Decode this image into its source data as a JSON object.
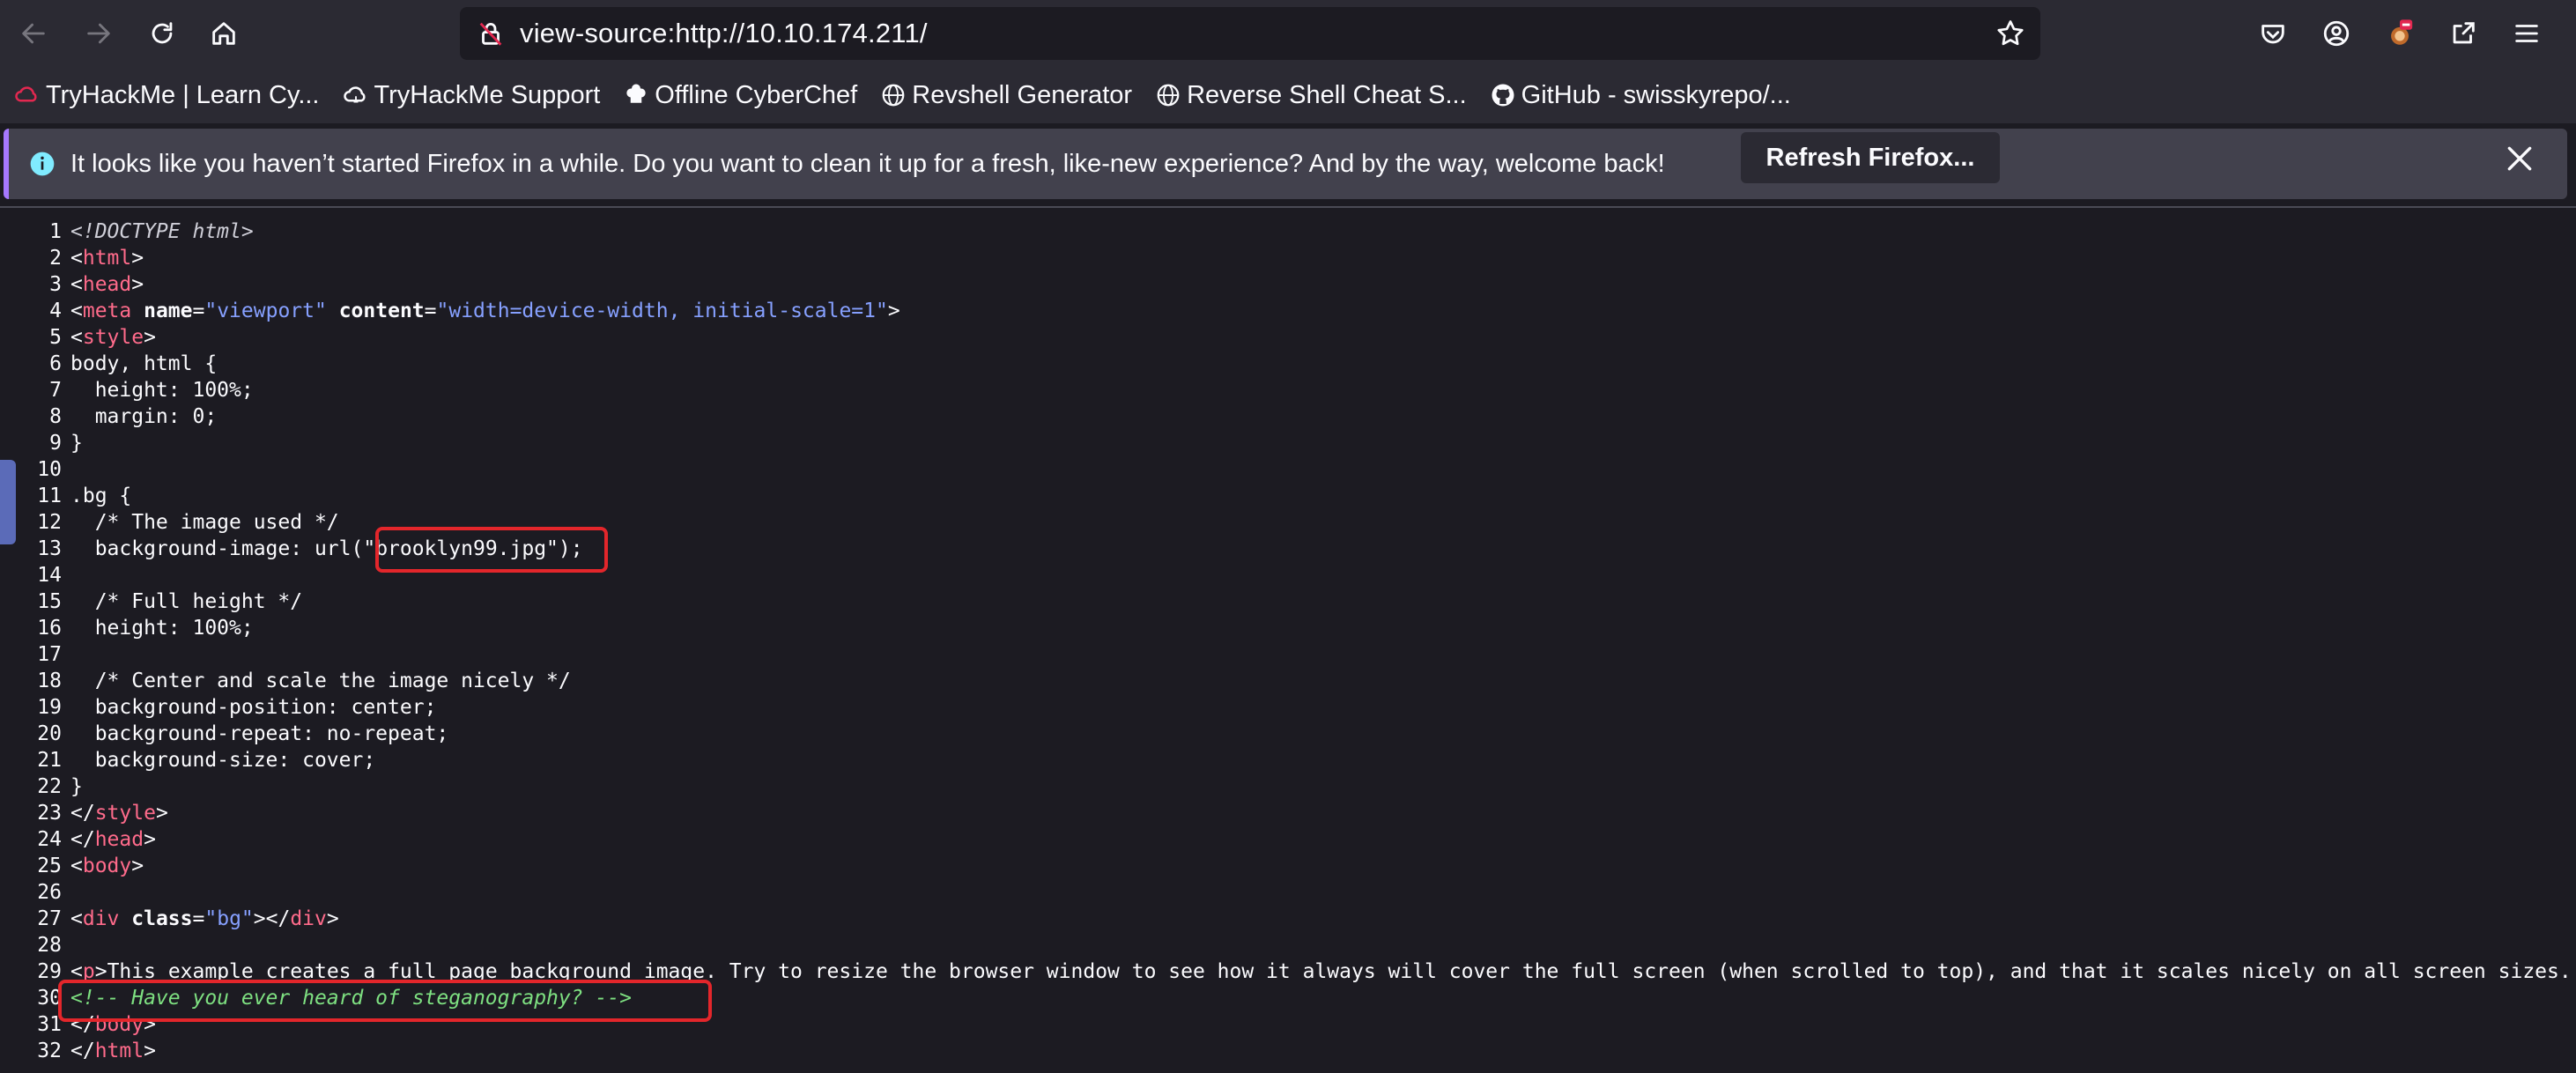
{
  "toolbar": {
    "url": "view-source:http://10.10.174.211/",
    "icons": [
      "back-arrow-icon",
      "forward-arrow-icon",
      "reload-icon",
      "home-icon",
      "lock-icon",
      "star-icon",
      "pocket-icon",
      "account-icon",
      "extension-icon",
      "share-icon",
      "menu-icon"
    ]
  },
  "bookmarks": [
    {
      "label": "TryHackMe | Learn Cy...",
      "icon": "tryhackme-icon"
    },
    {
      "label": "TryHackMe Support",
      "icon": "support-icon"
    },
    {
      "label": "Offline CyberChef",
      "icon": "chef-icon"
    },
    {
      "label": "Revshell Generator",
      "icon": "globe-icon"
    },
    {
      "label": "Reverse Shell Cheat S...",
      "icon": "globe-icon"
    },
    {
      "label": "GitHub - swisskyrepo/...",
      "icon": "github-icon"
    }
  ],
  "notification": {
    "message": "It looks like you haven’t started Firefox in a while. Do you want to clean it up for a fresh, like-new experience? And by the way, welcome back!",
    "button": "Refresh Firefox..."
  },
  "source": {
    "line_numbers": [
      "1",
      "2",
      "3",
      "4",
      "5",
      "6",
      "7",
      "8",
      "9",
      "10",
      "11",
      "12",
      "13",
      "14",
      "15",
      "16",
      "17",
      "18",
      "19",
      "20",
      "21",
      "22",
      "23",
      "24",
      "25",
      "26",
      "27",
      "28",
      "29",
      "30",
      "31",
      "32"
    ],
    "text": {
      "doctype": "<!DOCTYPE html>",
      "html": "html",
      "head": "head",
      "meta": "meta",
      "style": "style",
      "body": "body",
      "div": "div",
      "p": "p",
      "name_attr": "name",
      "name_val": "\"viewport\"",
      "content_attr": "content",
      "content_val": "\"width=device-width, initial-scale=1\"",
      "l6": "body, html {",
      "l7": "  height: 100%;",
      "l8": "  margin: 0;",
      "l9": "}",
      "l11": ".bg {",
      "l12": "  /* The image used */",
      "l13a": "  background-image: url(",
      "l13b": "\"brooklyn99.jpg\");",
      "l15": "  /* Full height */",
      "l16": "  height: 100%;",
      "l18": "  /* Center and scale the image nicely */",
      "l19": "  background-position: center;",
      "l20": "  background-repeat: no-repeat;",
      "l21": "  background-size: cover;",
      "l22": "}",
      "class_attr": "class",
      "class_val": "\"bg\"",
      "l29": "This example creates a full page background image. Try to resize the browser window to see how it always will cover the full screen (when scrolled to top), and that it scales nicely on all screen sizes.",
      "l30": "<!-- Have you ever heard of steganography? -->"
    }
  },
  "colors": {
    "tag": "#ff6b8b",
    "value": "#86a0ff",
    "comment": "#7ee081",
    "highlight": "#e3262b"
  }
}
